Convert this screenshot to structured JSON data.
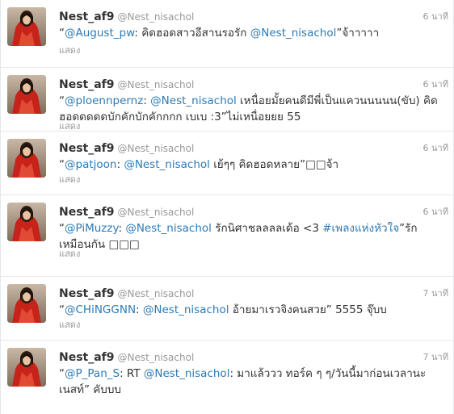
{
  "tweets": [
    {
      "fullname": "Nest_af9",
      "username": "@Nest_nisachol",
      "time": "6 นาที",
      "parts": [
        {
          "t": "“",
          "link": false
        },
        {
          "t": "@August_pw",
          "link": true
        },
        {
          "t": ": คิดฮอดสาวอีสานรอรัก ",
          "link": false
        },
        {
          "t": "@Nest_nisachol",
          "link": true
        },
        {
          "t": "”จ้าาาาา",
          "link": false
        }
      ],
      "expand": "แสดง"
    },
    {
      "fullname": "Nest_af9",
      "username": "@Nest_nisachol",
      "time": "6 นาที",
      "parts": [
        {
          "t": "“",
          "link": false
        },
        {
          "t": "@ploennpernz",
          "link": true
        },
        {
          "t": ": ",
          "link": false
        },
        {
          "t": "@Nest_nisachol",
          "link": true
        },
        {
          "t": " เหนื่อยมั้ยคนดีมีพี่เป็นแควนนนนน(ขับ) คิดฮอดดดดดบักคักบักคักกกก เบเบ :3”ไม่เหนื่อยยย 55",
          "link": false
        }
      ],
      "expand": "แสดง"
    },
    {
      "fullname": "Nest_af9",
      "username": "@Nest_nisachol",
      "time": "6 นาที",
      "parts": [
        {
          "t": "“",
          "link": false
        },
        {
          "t": "@patjoon",
          "link": true
        },
        {
          "t": ": ",
          "link": false
        },
        {
          "t": "@Nest_nisachol",
          "link": true
        },
        {
          "t": " เย้ๆๆ คิดฮอดหลาย”□□จ้า",
          "link": false
        }
      ],
      "expand": "แสดง"
    },
    {
      "fullname": "Nest_af9",
      "username": "@Nest_nisachol",
      "time": "6 นาที",
      "parts": [
        {
          "t": "“",
          "link": false
        },
        {
          "t": "@PiMuzzy",
          "link": true
        },
        {
          "t": ": ",
          "link": false
        },
        {
          "t": "@Nest_nisachol",
          "link": true
        },
        {
          "t": " รักนิศาชลลลลเด้อ <3 ",
          "link": false
        },
        {
          "t": "#เพลงแห่งหัวใจ",
          "link": true
        },
        {
          "t": "”รักเหมือนกัน □□□",
          "link": false
        }
      ],
      "expand": "แสดง"
    },
    {
      "fullname": "Nest_af9",
      "username": "@Nest_nisachol",
      "time": "7 นาที",
      "parts": [
        {
          "t": "“",
          "link": false
        },
        {
          "t": "@CHiNGGNN",
          "link": true
        },
        {
          "t": ": ",
          "link": false
        },
        {
          "t": "@Nest_nisachol",
          "link": true
        },
        {
          "t": " อ้ายมาเรวจิงคนสวย” 5555 จุ๊บบ",
          "link": false
        }
      ],
      "expand": "แสดง"
    },
    {
      "fullname": "Nest_af9",
      "username": "@Nest_nisachol",
      "time": "7 นาที",
      "parts": [
        {
          "t": "“",
          "link": false
        },
        {
          "t": "@P_Pan_S",
          "link": true
        },
        {
          "t": ": RT ",
          "link": false
        },
        {
          "t": "@Nest_nisachol",
          "link": true
        },
        {
          "t": ": มาแล้ววว ทอร์ค ๆ ๆ/วันนี้มาก่อนเวลานะเนสท์” คับบบ",
          "link": false
        }
      ],
      "expand": ""
    }
  ]
}
